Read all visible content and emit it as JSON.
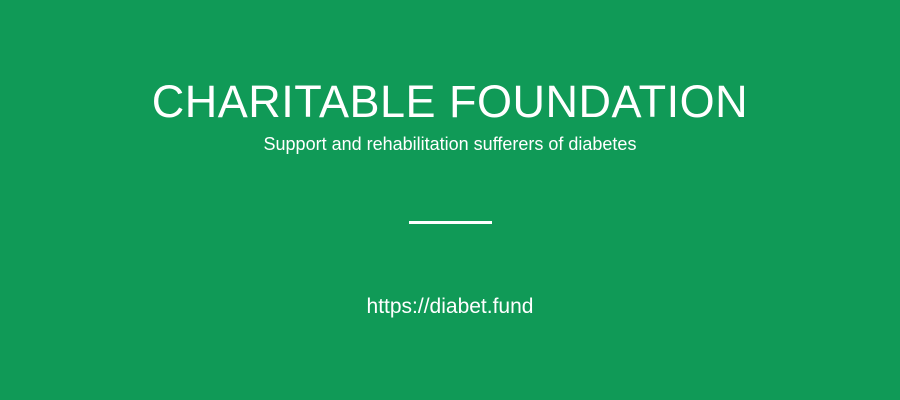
{
  "banner": {
    "title": "CHARITABLE FOUNDATION",
    "subtitle": "Support and rehabilitation sufferers of diabetes",
    "url": "https://diabet.fund"
  },
  "colors": {
    "background": "#109a57",
    "text": "#ffffff"
  }
}
